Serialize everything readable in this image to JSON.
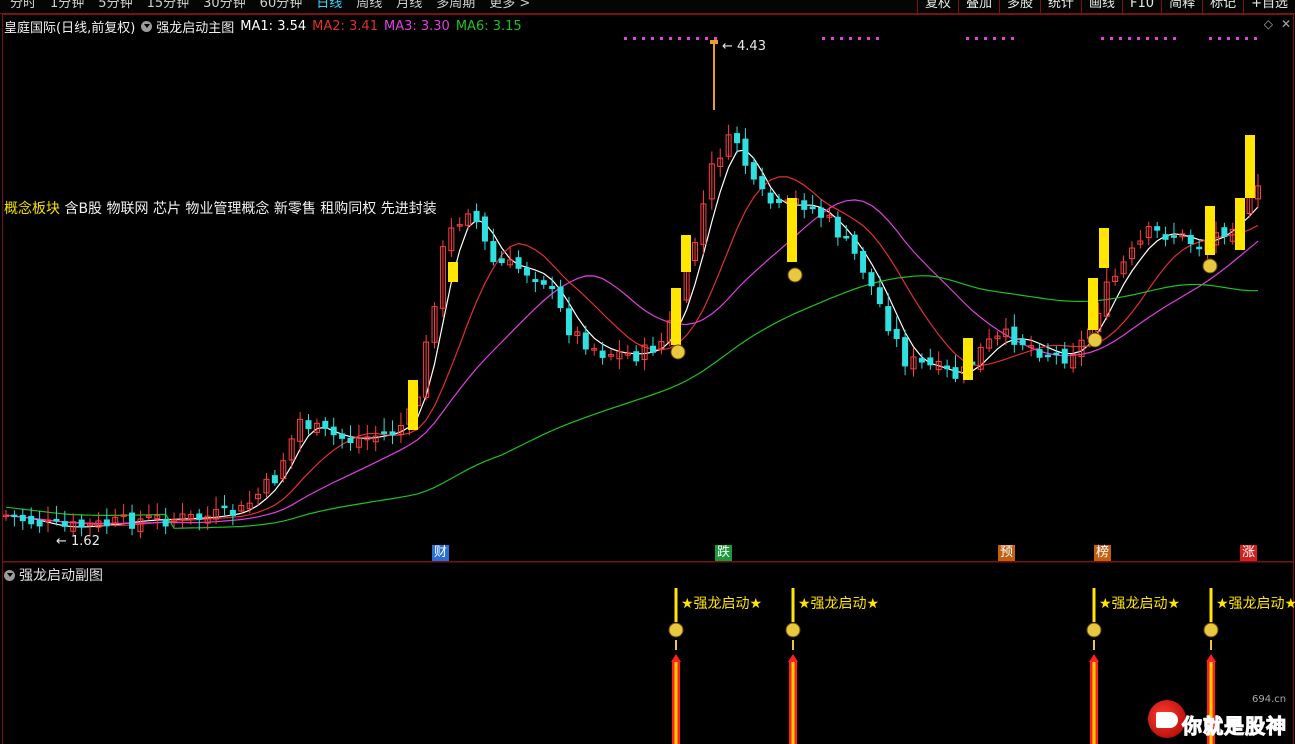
{
  "toolbar": {
    "periods": [
      "分时",
      "1分钟",
      "5分钟",
      "15分钟",
      "30分钟",
      "60分钟",
      "日线",
      "周线",
      "月线",
      "多周期",
      "更多 >"
    ],
    "active_period": "日线",
    "tools": [
      "复权",
      "叠加",
      "多股",
      "统计",
      "画线",
      "F10",
      "简释",
      "标记",
      "+自选"
    ]
  },
  "stock_title": "皇庭国际(日线,前复权)",
  "indicator_name": "强龙启动主图",
  "ma": [
    {
      "label": "MA1: 3.54",
      "color": "#ffffff"
    },
    {
      "label": "MA2: 3.41",
      "color": "#e03030"
    },
    {
      "label": "MA3: 3.30",
      "color": "#e040e0"
    },
    {
      "label": "MA6: 3.15",
      "color": "#20c020"
    }
  ],
  "concept": {
    "label": "概念板块",
    "tags": "含B股 物联网 芯片 物业管理概念 新零售 租购同权 先进封装"
  },
  "price_high_label": "4.43",
  "price_low_label": "1.62",
  "events": [
    {
      "text": "财",
      "color": "#2a6fd6"
    },
    {
      "text": "跌",
      "color": "#1a9a3a"
    },
    {
      "text": "预",
      "color": "#c06010"
    },
    {
      "text": "榜",
      "color": "#c06010"
    },
    {
      "text": "涨",
      "color": "#d02020"
    }
  ],
  "sub_indicator_name": "强龙启动副图",
  "signal_label": "★强龙启动★",
  "watermark": {
    "text": "你就是股神",
    "url": "694.cn"
  },
  "colors": {
    "up": "#ff4040",
    "down": "#30e0e0",
    "signal_bar": "#ffe600",
    "grid_line": "#7a1212"
  }
}
